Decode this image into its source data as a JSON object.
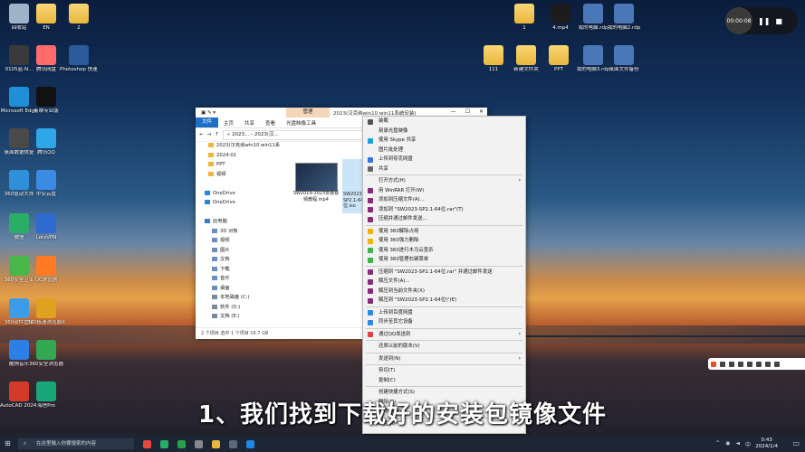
{
  "desktop_left": [
    {
      "label": "回收站",
      "color": "#9fb3c8"
    },
    {
      "label": "EN",
      "color": "folder"
    },
    {
      "label": "2",
      "color": "folder"
    },
    {
      "label": "0105蓝-N...",
      "color": "#3a3a3a"
    },
    {
      "label": "腾讯网盘",
      "color": "#ff6a6a"
    },
    {
      "label": "Photoshop 快速方式",
      "color": "#2c5a9a"
    },
    {
      "label": "Microsoft Edge",
      "color": "#1f8fd6"
    },
    {
      "label": "剪映专业版",
      "color": "#111111"
    },
    {
      "label": "桌面数据恢复",
      "color": "#4a4a4a"
    },
    {
      "label": "腾讯QQ",
      "color": "#2ea6e8"
    },
    {
      "label": "360驱动大师",
      "color": "#2f8fd8"
    },
    {
      "label": "中安云盘",
      "color": "#3b8be2"
    },
    {
      "label": "微信",
      "color": "#2aae67"
    },
    {
      "label": "LetsVPN",
      "color": "#2d6bd1"
    },
    {
      "label": "360安全卫士",
      "color": "#49b649"
    },
    {
      "label": "UC浏览器",
      "color": "#ff7a22"
    },
    {
      "label": "360软件管家",
      "color": "#3b9de8"
    },
    {
      "label": "360极速浏览器X",
      "color": "#e0a020"
    },
    {
      "label": "酷狗音乐",
      "color": "#2d7fe8"
    },
    {
      "label": "360安全浏览器",
      "color": "#32a852"
    },
    {
      "label": "AutoCAD 2024 - 简体中文",
      "color": "#d33a2a"
    },
    {
      "label": "海信Pro",
      "color": "#19a779"
    }
  ],
  "desktop_right": [
    {
      "label": "1",
      "color": "folder"
    },
    {
      "label": "4.mp4",
      "color": "#1c1c1c"
    },
    {
      "label": "我的电脑.rdp",
      "color": "#4a77b8"
    },
    {
      "label": "我的电脑2.rdp",
      "color": "#4a77b8"
    },
    {
      "label": "111",
      "color": "folder"
    },
    {
      "label": "新建文件夹",
      "color": "folder"
    },
    {
      "label": "PPT",
      "color": "folder"
    },
    {
      "label": "我的电脑3.rdp",
      "color": "#4a77b8"
    },
    {
      "label": "桌面文件备份",
      "color": "#4a77b8"
    }
  ],
  "timer": {
    "time": "00:00:08",
    "pause_icon": "pause-icon",
    "stop_icon": "stop-icon"
  },
  "explorer": {
    "manage_tab": "管理",
    "title": "2023(汉克纳win10 win11系统安装)",
    "winbtns": [
      "—",
      "☐",
      "✕"
    ],
    "ribbon": [
      "文件",
      "主页",
      "共享",
      "查看",
      "光盘映像工具"
    ],
    "address_parts": [
      "«",
      "2023...",
      "2023(汉..."
    ],
    "search_placeholder": "搜索",
    "nav": [
      {
        "label": "2023(汉克纳win10 win11系",
        "kind": "folder"
      },
      {
        "label": "2024-01",
        "kind": "folder"
      },
      {
        "label": "PPT",
        "kind": "folder"
      },
      {
        "label": "视频",
        "kind": "folder"
      },
      {
        "label": "",
        "kind": "blank"
      },
      {
        "label": "OneDrive",
        "kind": "cloud"
      },
      {
        "label": "OneDrive",
        "kind": "cloud"
      },
      {
        "label": "",
        "kind": "blank"
      },
      {
        "label": "此电脑",
        "kind": "pc"
      },
      {
        "label": "3D 对象",
        "kind": "obj"
      },
      {
        "label": "视频",
        "kind": "obj"
      },
      {
        "label": "图片",
        "kind": "obj"
      },
      {
        "label": "文档",
        "kind": "obj"
      },
      {
        "label": "下载",
        "kind": "obj"
      },
      {
        "label": "音乐",
        "kind": "obj"
      },
      {
        "label": "桌面",
        "kind": "obj"
      },
      {
        "label": "本地磁盘 (C:)",
        "kind": "drive"
      },
      {
        "label": "软件 (D:)",
        "kind": "drive"
      },
      {
        "label": "文档 (E:)",
        "kind": "drive"
      }
    ],
    "file1": "SW2019-2023安装视频教程.mp4",
    "file2": "SW2023-SP2.1-64位.iso",
    "status": "2 个项目    选中 1 个项目  16.7 GB"
  },
  "context_menu": [
    {
      "label": "装载",
      "icon": "#555555"
    },
    {
      "label": "刻录光盘映像",
      "icon": ""
    },
    {
      "label": "使用 Skype 共享",
      "icon": "#1aa0e0"
    },
    {
      "label": "图片批处理",
      "icon": ""
    },
    {
      "label": "上传到夸克网盘",
      "icon": "#3a6ee8"
    },
    {
      "label": "共享",
      "icon": "#666666"
    },
    {
      "sep": true
    },
    {
      "label": "打开方式(H)",
      "icon": "",
      "arrow": true
    },
    {
      "label": "用 WinRAR 打开(W)",
      "icon": "#8a2a7a"
    },
    {
      "label": "添加到压缩文件(A)...",
      "icon": "#8a2a7a"
    },
    {
      "label": "添加到 \"SW2023-SP2.1-64位.rar\"(T)",
      "icon": "#8a2a7a"
    },
    {
      "label": "压缩并通过邮件发送...",
      "icon": "#8a2a7a"
    },
    {
      "sep": true
    },
    {
      "label": "使用 360解除占用",
      "icon": "#f0b400"
    },
    {
      "label": "使用 360强力删除",
      "icon": "#f0b400"
    },
    {
      "label": "使用 360进行木马云查杀",
      "icon": "#3bb54a"
    },
    {
      "label": "使用 360管理右键菜单",
      "icon": "#3bb54a"
    },
    {
      "sep": true
    },
    {
      "label": "压缩到 \"SW2023-SP2.1-64位.rar\" 并通过邮件发送",
      "icon": "#8a2a7a"
    },
    {
      "label": "解压文件(A)...",
      "icon": "#8a2a7a"
    },
    {
      "label": "解压到当前文件夹(X)",
      "icon": "#8a2a7a"
    },
    {
      "label": "解压到 \"SW2023-SP2.1-64位\\\"(E)",
      "icon": "#8a2a7a"
    },
    {
      "sep": true
    },
    {
      "label": "上传到百度网盘",
      "icon": "#2a8ae8"
    },
    {
      "label": "同步至其它设备",
      "icon": "#2a8ae8"
    },
    {
      "sep": true
    },
    {
      "label": "通过QQ发送到",
      "icon": "#e04040",
      "arrow": true
    },
    {
      "sep": true
    },
    {
      "label": "还原以前的版本(V)",
      "icon": ""
    },
    {
      "sep": true
    },
    {
      "label": "发送到(N)",
      "icon": "",
      "arrow": true
    },
    {
      "sep": true
    },
    {
      "label": "剪切(T)",
      "icon": ""
    },
    {
      "label": "复制(C)",
      "icon": ""
    },
    {
      "sep": true
    },
    {
      "label": "创建快捷方式(S)",
      "icon": ""
    },
    {
      "label": "删除(D)",
      "icon": ""
    },
    {
      "label": "重命名(M)",
      "icon": ""
    },
    {
      "sep": true
    },
    {
      "label": "属性(R)",
      "icon": ""
    }
  ],
  "caption": "1、我们找到下载好的安装包镜像文件",
  "taskbar": {
    "search_placeholder": "在这里输入你要搜索的内容",
    "time": "0:43",
    "date": "2024/1/4"
  }
}
